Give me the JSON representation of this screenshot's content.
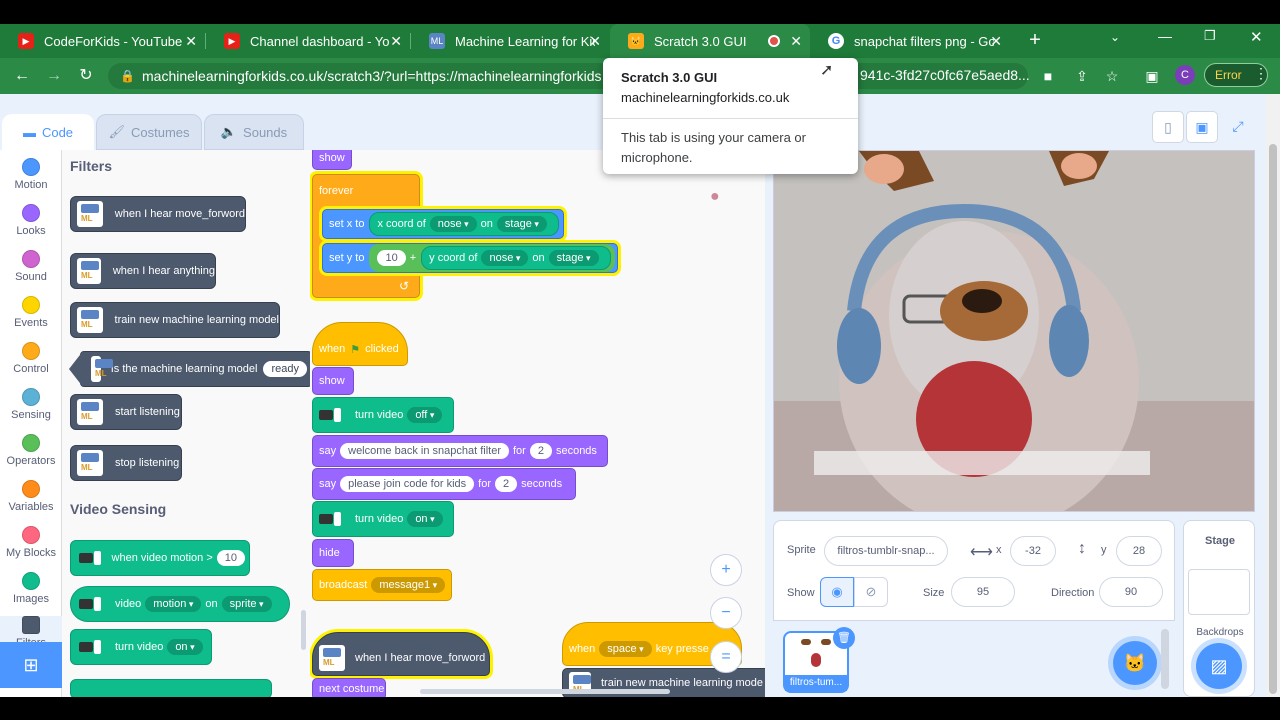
{
  "browser": {
    "tabs": [
      {
        "title": "CodeForKids - YouTube",
        "icon": "youtube-icon"
      },
      {
        "title": "Channel dashboard - You",
        "icon": "youtube-icon"
      },
      {
        "title": "Machine Learning for Kid",
        "icon": "ml4k-icon"
      },
      {
        "title": "Scratch 3.0 GUI",
        "icon": "scratch-cat-icon"
      },
      {
        "title": "snapchat filters png - Go",
        "icon": "google-icon"
      }
    ],
    "new_tab": "+",
    "url": "machinelearningforkids.co.uk/scratch3/?url=https://machinelearningforkids",
    "url_tail": "941c-3fd27c0fc67e5aed8...",
    "avatar_letter": "C",
    "error_label": "Error"
  },
  "popup": {
    "title": "Scratch 3.0 GUI",
    "domain": "machinelearningforkids.co.uk",
    "message": "This tab is using your camera or microphone."
  },
  "editor_tabs": {
    "code": "Code",
    "costumes": "Costumes",
    "sounds": "Sounds"
  },
  "categories": [
    {
      "label": "Motion",
      "color": "#4c97ff"
    },
    {
      "label": "Looks",
      "color": "#9966ff"
    },
    {
      "label": "Sound",
      "color": "#cf63cf"
    },
    {
      "label": "Events",
      "color": "#ffd500"
    },
    {
      "label": "Control",
      "color": "#ffab19"
    },
    {
      "label": "Sensing",
      "color": "#5cb1d6"
    },
    {
      "label": "Operators",
      "color": "#59c059"
    },
    {
      "label": "Variables",
      "color": "#ff8c1a"
    },
    {
      "label": "My Blocks",
      "color": "#ff6680"
    },
    {
      "label": "Images",
      "color": "#0fbd8c"
    },
    {
      "label": "Filters",
      "color": "#4d5a6e"
    }
  ],
  "palette": {
    "filters_title": "Filters",
    "ml_blocks": [
      "when I hear move_forword",
      "when I hear anything",
      "train new machine learning model",
      "Is the machine learning model",
      "start listening",
      "stop listening"
    ],
    "ready": "ready",
    "video_title": "Video Sensing",
    "video_motion": "when video motion >",
    "video_motion_val": "10",
    "video_word": "video",
    "motion_opt": "motion",
    "on_word": "on",
    "sprite_opt": "sprite",
    "turn_video": "turn video",
    "on_opt": "on"
  },
  "script": {
    "show": "show",
    "forever": "forever",
    "set_x": "set x to",
    "x_coord": "x coord of",
    "nose": "nose",
    "on": "on",
    "stage": "stage",
    "set_y": "set y to",
    "ten": "10",
    "plus": "+",
    "y_coord": "y coord of",
    "when": "when",
    "clicked": "clicked",
    "show2": "show",
    "turn_video": "turn video",
    "off": "off",
    "say": "say",
    "say1_text": "welcome back in snapchat filter",
    "for": "for",
    "two": "2",
    "seconds": "seconds",
    "say2_text": "please join code for kids",
    "on_opt": "on",
    "hide": "hide",
    "broadcast": "broadcast",
    "message1": "message1",
    "hear_move": "when I hear move_forword",
    "next_costume": "next costume",
    "when_key": "when",
    "space": "space",
    "key_pressed": "key presse",
    "train": "train new machine learning mode",
    "zoom_in": "+",
    "zoom_out": "−",
    "zoom_reset": "="
  },
  "sprite": {
    "label": "Sprite",
    "name": "filtros-tumblr-snap...",
    "x_label": "x",
    "x": "-32",
    "y_label": "y",
    "y": "28",
    "show_label": "Show",
    "size_label": "Size",
    "size": "95",
    "direction_label": "Direction",
    "direction": "90",
    "thumb_name": "filtros-tum..."
  },
  "stage_pane": {
    "label": "Stage",
    "backdrops": "Backdrops"
  }
}
